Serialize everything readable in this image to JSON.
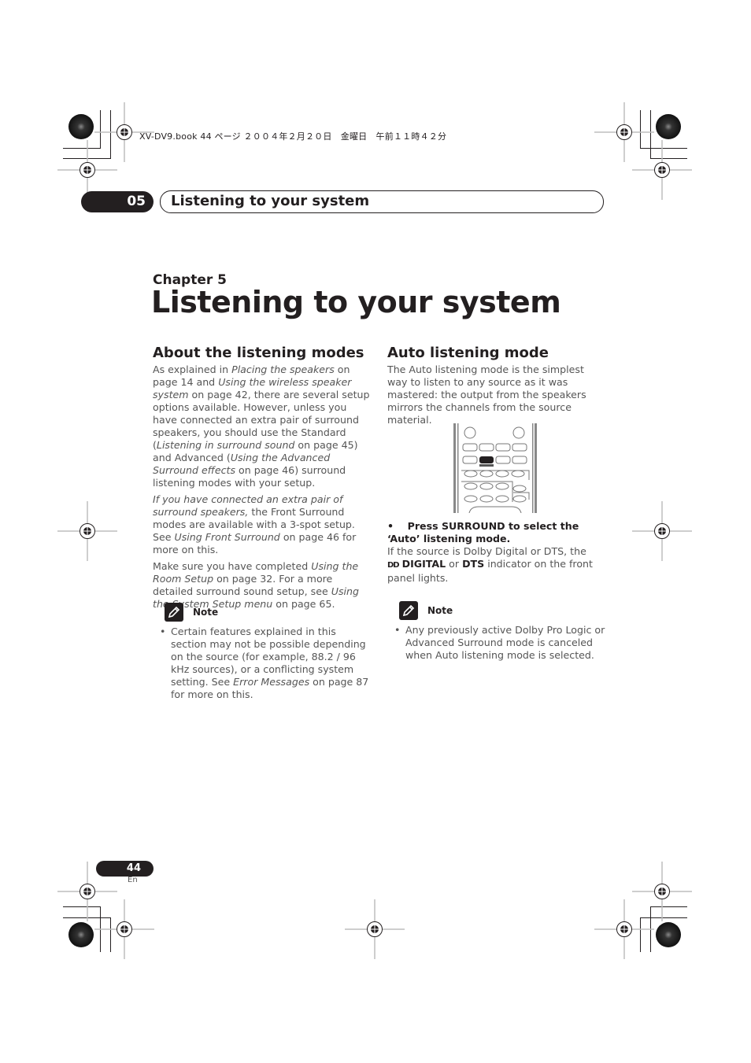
{
  "slug": "XV-DV9.book  44 ページ  ２００４年２月２０日　金曜日　午前１１時４２分",
  "header": {
    "chapter_number": "05",
    "title": "Listening to your system"
  },
  "chapter_label": "Chapter 5",
  "page_title": "Listening to your system",
  "left_column": {
    "heading": "About the listening modes",
    "paragraphs": [
      [
        {
          "t": "As explained in "
        },
        {
          "t": "Placing the speakers",
          "i": true
        },
        {
          "t": " on page 14 and "
        },
        {
          "t": "Using the wireless speaker system",
          "i": true
        },
        {
          "t": " on page 42, there are several setup options available. However, unless you have connected an extra pair of surround speakers, you should use the Standard ("
        },
        {
          "t": "Listening in surround sound",
          "i": true
        },
        {
          "t": " on page 45) and Advanced ("
        },
        {
          "t": "Using the Advanced Surround effects",
          "i": true
        },
        {
          "t": " on page 46) surround listening modes with your setup."
        }
      ],
      [
        {
          "t": "If you have connected an extra pair of surround speakers,",
          "i": true
        },
        {
          "t": " the Front Surround modes are available with a 3-spot setup. See "
        },
        {
          "t": "Using Front Surround",
          "i": true
        },
        {
          "t": " on page 46 for more on this."
        }
      ],
      [
        {
          "t": "Make sure you have completed "
        },
        {
          "t": "Using the Room Setup",
          "i": true
        },
        {
          "t": " on page 32. For a more detailed surround sound setup, see "
        },
        {
          "t": "Using the System Setup menu",
          "i": true
        },
        {
          "t": " on page 65."
        }
      ]
    ],
    "note": {
      "label": "Note",
      "icon": "pencil-icon",
      "bullets": [
        [
          {
            "t": "Certain features explained in this section may not be possible depending on the source (for example, 88.2 / 96 kHz sources), or a conflicting system setting. See "
          },
          {
            "t": "Error Messages",
            "i": true
          },
          {
            "t": " on page 87 for more on this."
          }
        ]
      ]
    }
  },
  "right_column": {
    "heading": "Auto listening mode",
    "intro": "The Auto listening mode is the simplest way to listen to any source as it was mastered: the output from the speakers mirrors the channels from the source material.",
    "illustration": "remote-control-surround-button",
    "step": "Press SURROUND to select the ‘Auto’ listening mode.",
    "step_bullet": "•",
    "detail_pre": "If the source is Dolby Digital or DTS, the ",
    "dolby_symbol": "DD",
    "digital_label": "DIGITAL",
    "or_text": " or ",
    "dts_label": "DTS",
    "detail_post": " indicator on the front panel lights.",
    "note": {
      "label": "Note",
      "icon": "pencil-icon",
      "bullets": [
        "Any previously active Dolby Pro Logic or Advanced Surround mode is canceled when Auto listening mode is selected."
      ]
    }
  },
  "footer": {
    "page_number": "44",
    "language": "En"
  }
}
